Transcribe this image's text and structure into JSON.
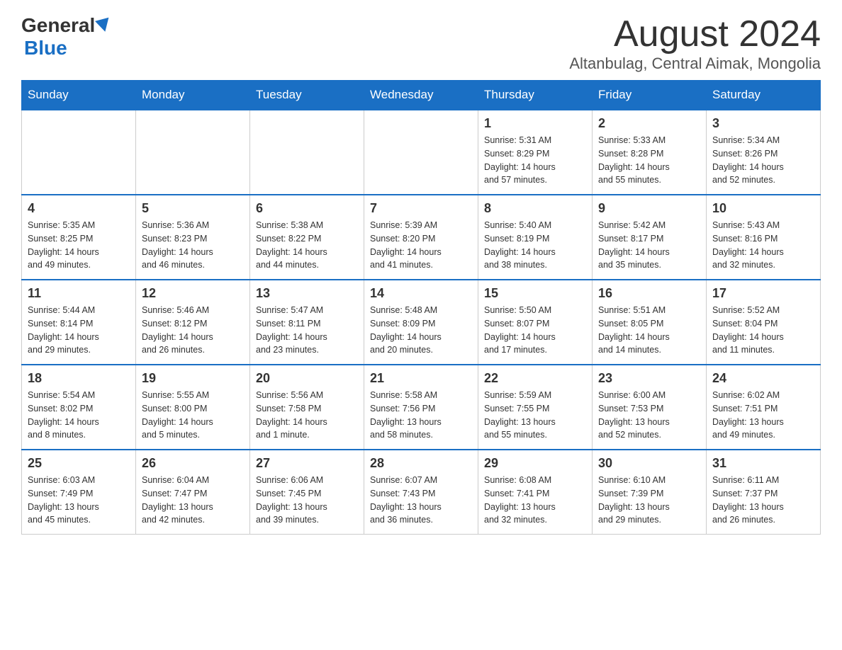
{
  "header": {
    "logo_general": "General",
    "logo_blue": "Blue",
    "month_title": "August 2024",
    "location": "Altanbulag, Central Aimak, Mongolia"
  },
  "days_of_week": [
    "Sunday",
    "Monday",
    "Tuesday",
    "Wednesday",
    "Thursday",
    "Friday",
    "Saturday"
  ],
  "weeks": [
    [
      {
        "day": "",
        "info": ""
      },
      {
        "day": "",
        "info": ""
      },
      {
        "day": "",
        "info": ""
      },
      {
        "day": "",
        "info": ""
      },
      {
        "day": "1",
        "info": "Sunrise: 5:31 AM\nSunset: 8:29 PM\nDaylight: 14 hours\nand 57 minutes."
      },
      {
        "day": "2",
        "info": "Sunrise: 5:33 AM\nSunset: 8:28 PM\nDaylight: 14 hours\nand 55 minutes."
      },
      {
        "day": "3",
        "info": "Sunrise: 5:34 AM\nSunset: 8:26 PM\nDaylight: 14 hours\nand 52 minutes."
      }
    ],
    [
      {
        "day": "4",
        "info": "Sunrise: 5:35 AM\nSunset: 8:25 PM\nDaylight: 14 hours\nand 49 minutes."
      },
      {
        "day": "5",
        "info": "Sunrise: 5:36 AM\nSunset: 8:23 PM\nDaylight: 14 hours\nand 46 minutes."
      },
      {
        "day": "6",
        "info": "Sunrise: 5:38 AM\nSunset: 8:22 PM\nDaylight: 14 hours\nand 44 minutes."
      },
      {
        "day": "7",
        "info": "Sunrise: 5:39 AM\nSunset: 8:20 PM\nDaylight: 14 hours\nand 41 minutes."
      },
      {
        "day": "8",
        "info": "Sunrise: 5:40 AM\nSunset: 8:19 PM\nDaylight: 14 hours\nand 38 minutes."
      },
      {
        "day": "9",
        "info": "Sunrise: 5:42 AM\nSunset: 8:17 PM\nDaylight: 14 hours\nand 35 minutes."
      },
      {
        "day": "10",
        "info": "Sunrise: 5:43 AM\nSunset: 8:16 PM\nDaylight: 14 hours\nand 32 minutes."
      }
    ],
    [
      {
        "day": "11",
        "info": "Sunrise: 5:44 AM\nSunset: 8:14 PM\nDaylight: 14 hours\nand 29 minutes."
      },
      {
        "day": "12",
        "info": "Sunrise: 5:46 AM\nSunset: 8:12 PM\nDaylight: 14 hours\nand 26 minutes."
      },
      {
        "day": "13",
        "info": "Sunrise: 5:47 AM\nSunset: 8:11 PM\nDaylight: 14 hours\nand 23 minutes."
      },
      {
        "day": "14",
        "info": "Sunrise: 5:48 AM\nSunset: 8:09 PM\nDaylight: 14 hours\nand 20 minutes."
      },
      {
        "day": "15",
        "info": "Sunrise: 5:50 AM\nSunset: 8:07 PM\nDaylight: 14 hours\nand 17 minutes."
      },
      {
        "day": "16",
        "info": "Sunrise: 5:51 AM\nSunset: 8:05 PM\nDaylight: 14 hours\nand 14 minutes."
      },
      {
        "day": "17",
        "info": "Sunrise: 5:52 AM\nSunset: 8:04 PM\nDaylight: 14 hours\nand 11 minutes."
      }
    ],
    [
      {
        "day": "18",
        "info": "Sunrise: 5:54 AM\nSunset: 8:02 PM\nDaylight: 14 hours\nand 8 minutes."
      },
      {
        "day": "19",
        "info": "Sunrise: 5:55 AM\nSunset: 8:00 PM\nDaylight: 14 hours\nand 5 minutes."
      },
      {
        "day": "20",
        "info": "Sunrise: 5:56 AM\nSunset: 7:58 PM\nDaylight: 14 hours\nand 1 minute."
      },
      {
        "day": "21",
        "info": "Sunrise: 5:58 AM\nSunset: 7:56 PM\nDaylight: 13 hours\nand 58 minutes."
      },
      {
        "day": "22",
        "info": "Sunrise: 5:59 AM\nSunset: 7:55 PM\nDaylight: 13 hours\nand 55 minutes."
      },
      {
        "day": "23",
        "info": "Sunrise: 6:00 AM\nSunset: 7:53 PM\nDaylight: 13 hours\nand 52 minutes."
      },
      {
        "day": "24",
        "info": "Sunrise: 6:02 AM\nSunset: 7:51 PM\nDaylight: 13 hours\nand 49 minutes."
      }
    ],
    [
      {
        "day": "25",
        "info": "Sunrise: 6:03 AM\nSunset: 7:49 PM\nDaylight: 13 hours\nand 45 minutes."
      },
      {
        "day": "26",
        "info": "Sunrise: 6:04 AM\nSunset: 7:47 PM\nDaylight: 13 hours\nand 42 minutes."
      },
      {
        "day": "27",
        "info": "Sunrise: 6:06 AM\nSunset: 7:45 PM\nDaylight: 13 hours\nand 39 minutes."
      },
      {
        "day": "28",
        "info": "Sunrise: 6:07 AM\nSunset: 7:43 PM\nDaylight: 13 hours\nand 36 minutes."
      },
      {
        "day": "29",
        "info": "Sunrise: 6:08 AM\nSunset: 7:41 PM\nDaylight: 13 hours\nand 32 minutes."
      },
      {
        "day": "30",
        "info": "Sunrise: 6:10 AM\nSunset: 7:39 PM\nDaylight: 13 hours\nand 29 minutes."
      },
      {
        "day": "31",
        "info": "Sunrise: 6:11 AM\nSunset: 7:37 PM\nDaylight: 13 hours\nand 26 minutes."
      }
    ]
  ]
}
